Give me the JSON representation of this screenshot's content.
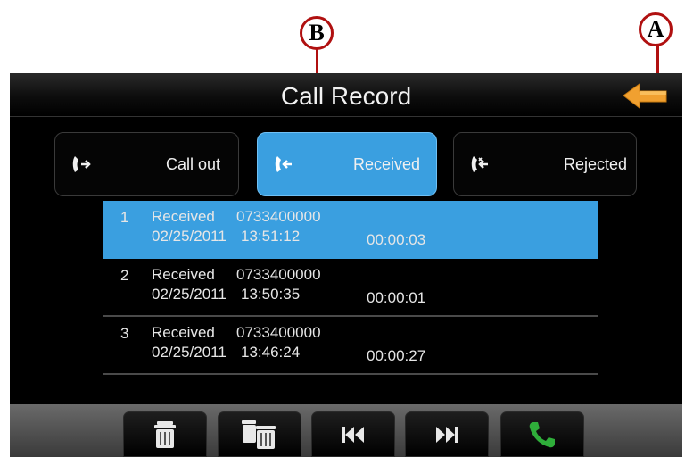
{
  "annotations": {
    "a_label": "A",
    "b_label": "B"
  },
  "header": {
    "title": "Call Record"
  },
  "tabs": [
    {
      "label": "Call out",
      "icon": "call-out-icon",
      "active": false
    },
    {
      "label": "Received",
      "icon": "call-received-icon",
      "active": true
    },
    {
      "label": "Rejected",
      "icon": "call-rejected-icon",
      "active": false
    }
  ],
  "records": [
    {
      "index": "1",
      "type": "Received",
      "number": "0733400000",
      "date": "02/25/2011",
      "time": "13:51:12",
      "duration": "00:00:03",
      "selected": true
    },
    {
      "index": "2",
      "type": "Received",
      "number": "0733400000",
      "date": "02/25/2011",
      "time": "13:50:35",
      "duration": "00:00:01",
      "selected": false
    },
    {
      "index": "3",
      "type": "Received",
      "number": "0733400000",
      "date": "02/25/2011",
      "time": "13:46:24",
      "duration": "00:00:27",
      "selected": false
    }
  ],
  "toolbar": [
    {
      "icon": "trash-icon"
    },
    {
      "icon": "delete-all-icon"
    },
    {
      "icon": "previous-icon"
    },
    {
      "icon": "next-icon"
    },
    {
      "icon": "phone-call-icon"
    }
  ],
  "colors": {
    "accent": "#3a9fe0",
    "back_arrow": "#f0a030",
    "call_green": "#2fae3a",
    "callout": "#b01010"
  }
}
